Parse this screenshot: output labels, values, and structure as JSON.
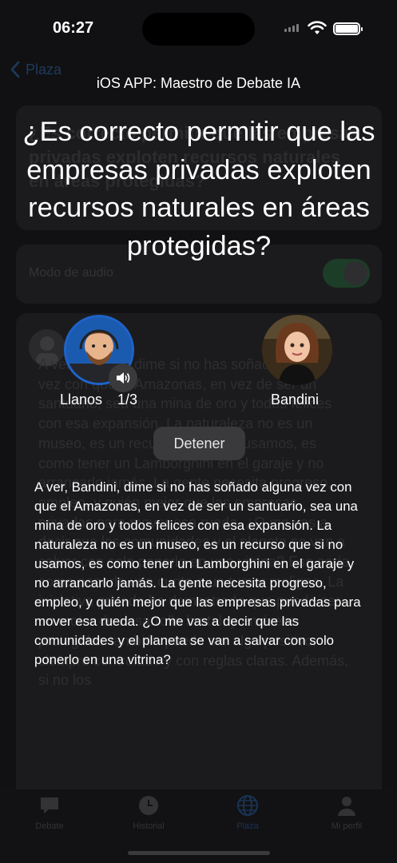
{
  "status_bar": {
    "time": "06:27"
  },
  "nav": {
    "back_label": "Plaza"
  },
  "background": {
    "question": "¿Es correcto permitir que las empresas privadas exploten recursos naturales en áreas protegidas?",
    "audio_mode_label": "Modo de audio",
    "audio_mode_on": true,
    "chat_text": "A ver, Bandini, dime si no has soñado alguna vez con que el Amazonas, en vez de ser un santuario, sea una mina de oro y todos felices con esa expansión. La naturaleza no es un museo, es un recurso que si no usamos, es como tener un Lamborghini en el garaje y no arrancarlo jamás. La gente necesita progreso, empleo, y quién mejor que las empresas privadas para mover esa rueda. ¿O me vas a decir que las comunidades y el planeta se van a salvar con solo ponerlo en una vitrina? Eso sería como ponerle una curita a un tumor maligno. La iniciativa privada ha demostrado que puede ser un motor de desarrollo brutal, y en áreas protegidas también puede ser algo positivo, siempre controlado y con reglas claras. Además, si no los"
  },
  "tabbar": {
    "tabs": [
      {
        "label": "Debate",
        "icon": "chat-bubble-icon",
        "active": false
      },
      {
        "label": "Historial",
        "icon": "clock-icon",
        "active": false
      },
      {
        "label": "Plaza",
        "icon": "globe-icon",
        "active": true
      },
      {
        "label": "Mi perfil",
        "icon": "person-icon",
        "active": false
      }
    ]
  },
  "overlay": {
    "app_title": "iOS APP: Maestro de Debate IA",
    "question": "¿Es correcto permitir que las empresas privadas exploten recursos naturales en áreas protegidas?",
    "speaker_left": {
      "name": "Llanos",
      "round": "1/3"
    },
    "speaker_right": {
      "name": "Bandini"
    },
    "stop_label": "Detener",
    "speech": "A ver, Bandini, dime si no has soñado alguna vez con que el Amazonas, en vez de ser un santuario, sea una mina de oro y todos felices con esa expansión. La naturaleza no es un museo, es un recurso que si no usamos, es como tener un Lamborghini en el garaje y no arrancarlo jamás. La gente necesita progreso, empleo, y quién mejor que las empresas privadas para mover esa rueda. ¿O me vas a decir que las comunidades y el planeta se van a salvar con solo ponerlo en una vitrina?"
  },
  "colors": {
    "accent_blue": "#1e63c8",
    "toggle_green": "#1c3d27",
    "overlay_text": "#ffffff"
  }
}
